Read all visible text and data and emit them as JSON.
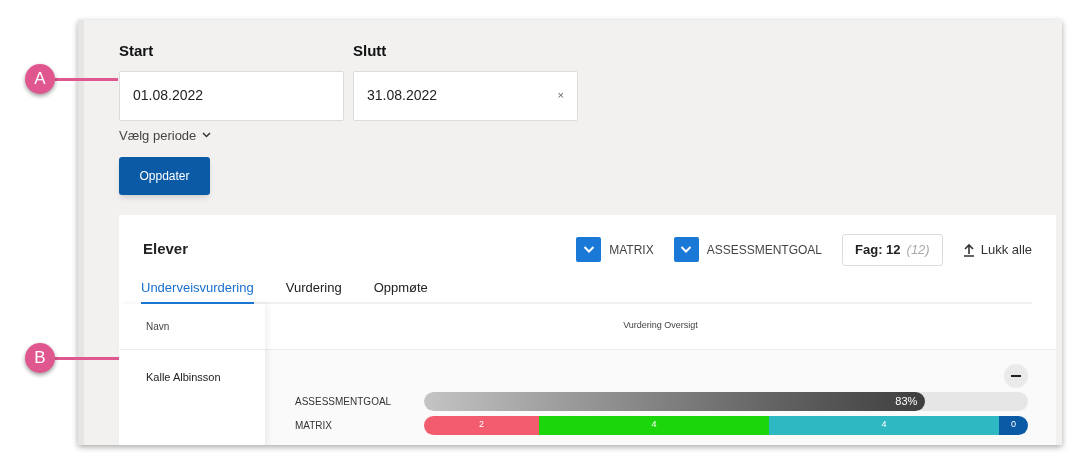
{
  "callouts": [
    {
      "label": "A"
    },
    {
      "label": "B"
    }
  ],
  "period": {
    "start": {
      "label": "Start",
      "value": "01.08.2022"
    },
    "end": {
      "label": "Slutt",
      "value": "31.08.2022",
      "clear": "×"
    },
    "preset": "Vælg periode",
    "update_button": "Oppdater"
  },
  "card": {
    "title": "Elever",
    "filters": [
      {
        "label": "MATRIX",
        "checked": true
      },
      {
        "label": "ASSESSMENTGOAL",
        "checked": true
      }
    ],
    "subjects": {
      "label": "Fag: 12",
      "total": "(12)"
    },
    "collapse_all": "Lukk alle",
    "tabs": [
      {
        "label": "Underveisvurdering",
        "selected": true
      },
      {
        "label": "Vurdering",
        "selected": false
      },
      {
        "label": "Oppmøte",
        "selected": false
      }
    ],
    "table": {
      "columns": [
        "Navn",
        "Vurdering Oversigt"
      ],
      "rows": [
        {
          "name": "Kalle Albinsson",
          "assessmentgoal": {
            "label": "ASSESSMENTGOAL",
            "level": 0.83,
            "reading": "83%"
          },
          "matrix": {
            "label": "MATRIX",
            "segments": [
              {
                "value": "2",
                "color": "#f25c6e"
              },
              {
                "value": "4",
                "color": "#1cd60c"
              },
              {
                "value": "4",
                "color": "#2db8c2"
              },
              {
                "value": "0",
                "color": "#0b5aa6"
              }
            ]
          }
        }
      ]
    }
  }
}
